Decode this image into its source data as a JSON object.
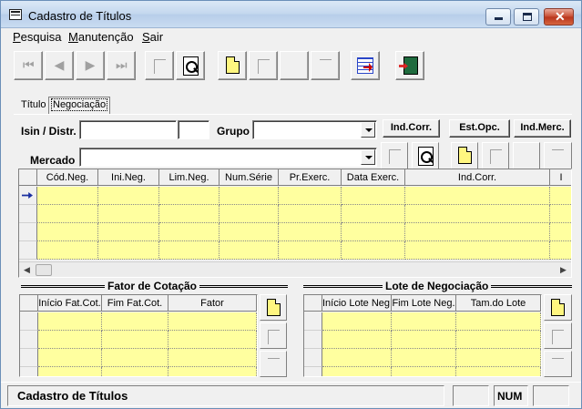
{
  "window": {
    "title": "Cadastro de Títulos"
  },
  "menu": [
    "Pesquisa",
    "Manutenção",
    "Sair"
  ],
  "tabs": {
    "titulo": "Título",
    "negociacao": "Negociação"
  },
  "form": {
    "isin_label": "Isin / Distr.",
    "isin_value": "",
    "distr_value": "",
    "grupo_label": "Grupo",
    "grupo_value": "",
    "mercado_label": "Mercado",
    "mercado_value": ""
  },
  "buttons": {
    "ind_corr": "Ind.Corr.",
    "est_opc": "Est.Opc.",
    "ind_merc": "Ind.Merc."
  },
  "neg_grid": {
    "columns": [
      "Cód.Neg.",
      "Ini.Neg.",
      "Lim.Neg.",
      "Num.Série",
      "Pr.Exerc.",
      "Data Exerc.",
      "Ind.Corr.",
      "I"
    ]
  },
  "fator": {
    "title": "Fator de Cotação",
    "columns": [
      "Início Fat.Cot.",
      "Fim Fat.Cot.",
      "Fator"
    ]
  },
  "lote": {
    "title": "Lote de Negociação",
    "columns": [
      "Início Lote Neg.",
      "Fim Lote Neg.",
      "Tam.do Lote"
    ]
  },
  "status": {
    "text": "Cadastro de Títulos",
    "box1": "",
    "num": "NUM",
    "box3": ""
  }
}
